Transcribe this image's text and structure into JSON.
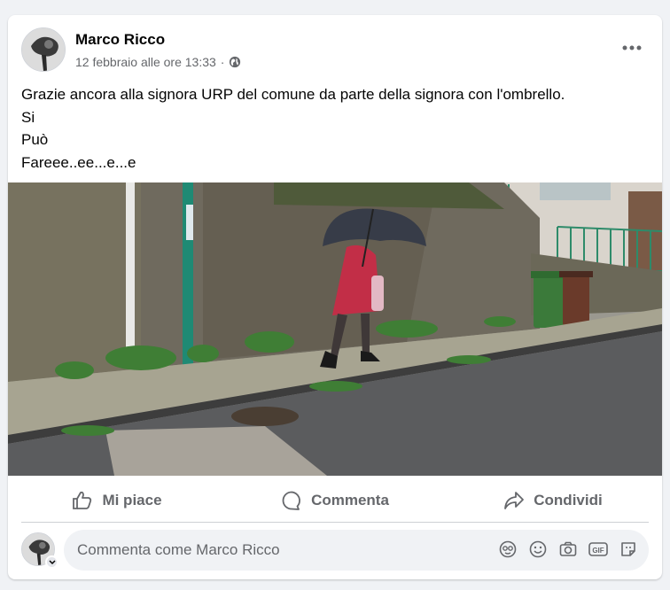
{
  "post": {
    "author": "Marco Ricco",
    "timestamp": "12 febbraio alle ore 13:33",
    "separator": "·",
    "audience_icon": "globe-icon",
    "more_icon": "more-dots-icon",
    "text_lines": [
      "Grazie ancora alla signora URP del comune da parte della signora con l'ombrello.",
      "Si",
      "Può",
      "Fareee..ee...e...e"
    ]
  },
  "actions": {
    "like_label": "Mi piace",
    "comment_label": "Commenta",
    "share_label": "Condividi"
  },
  "comment_box": {
    "placeholder": "Commenta come Marco Ricco",
    "icons": [
      "avatar-sticker-icon",
      "emoji-icon",
      "camera-icon",
      "gif-icon",
      "sticker-icon"
    ]
  },
  "colors": {
    "background": "#f0f2f5",
    "card": "#ffffff",
    "secondary_text": "#65676b",
    "primary_text": "#050505"
  }
}
